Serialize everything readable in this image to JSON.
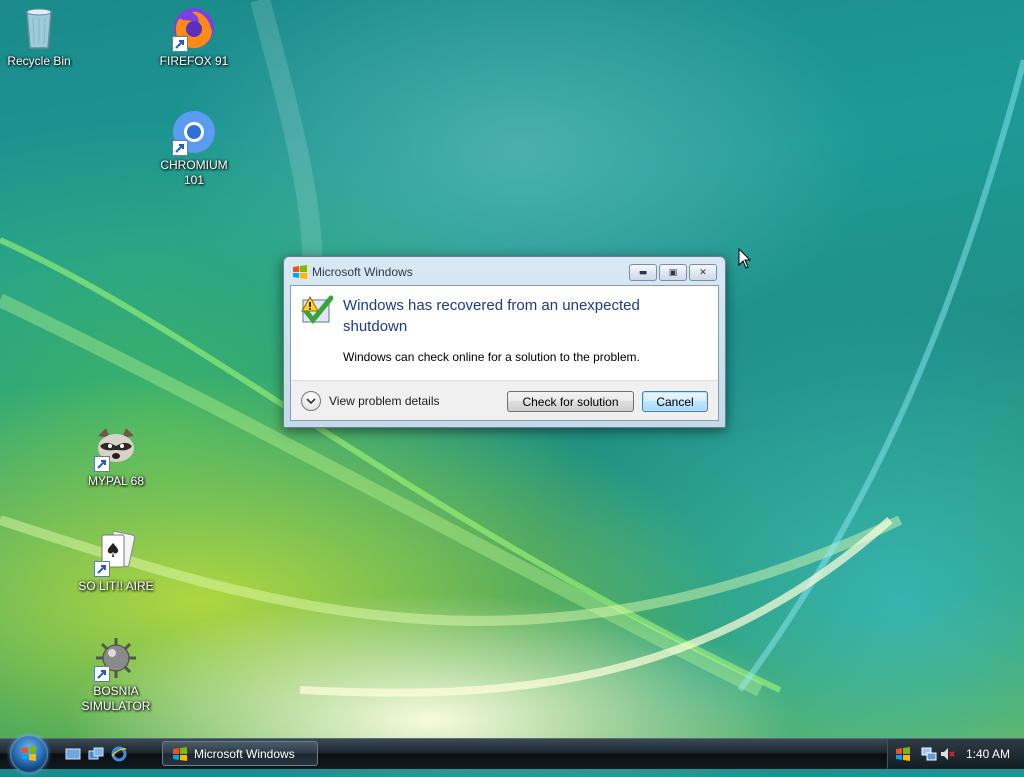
{
  "desktop": {
    "icons": [
      {
        "label": "Recycle Bin",
        "icon": "recycle-bin-icon"
      },
      {
        "label": "FIREFOX 91",
        "icon": "firefox-icon"
      },
      {
        "label": "CHROMIUM 101",
        "icon": "chromium-icon"
      },
      {
        "label": "MYPAL 68",
        "icon": "raccoon-icon"
      },
      {
        "label": "SO LIT!! AIRE",
        "icon": "solitaire-cards-icon"
      },
      {
        "label": "BOSNIA SIMULATOR",
        "icon": "mine-icon"
      }
    ]
  },
  "dialog": {
    "title": "Microsoft Windows",
    "heading": "Windows has recovered from an unexpected shutdown",
    "subtext": "Windows can check online for a solution to the problem.",
    "details_label": "View problem details",
    "check_button": "Check for solution",
    "cancel_button": "Cancel"
  },
  "taskbar": {
    "task_label": "Microsoft Windows",
    "clock": "1:40 AM"
  },
  "colors": {
    "heading": "#1e3a8a",
    "taskbar": "#1d262e"
  }
}
